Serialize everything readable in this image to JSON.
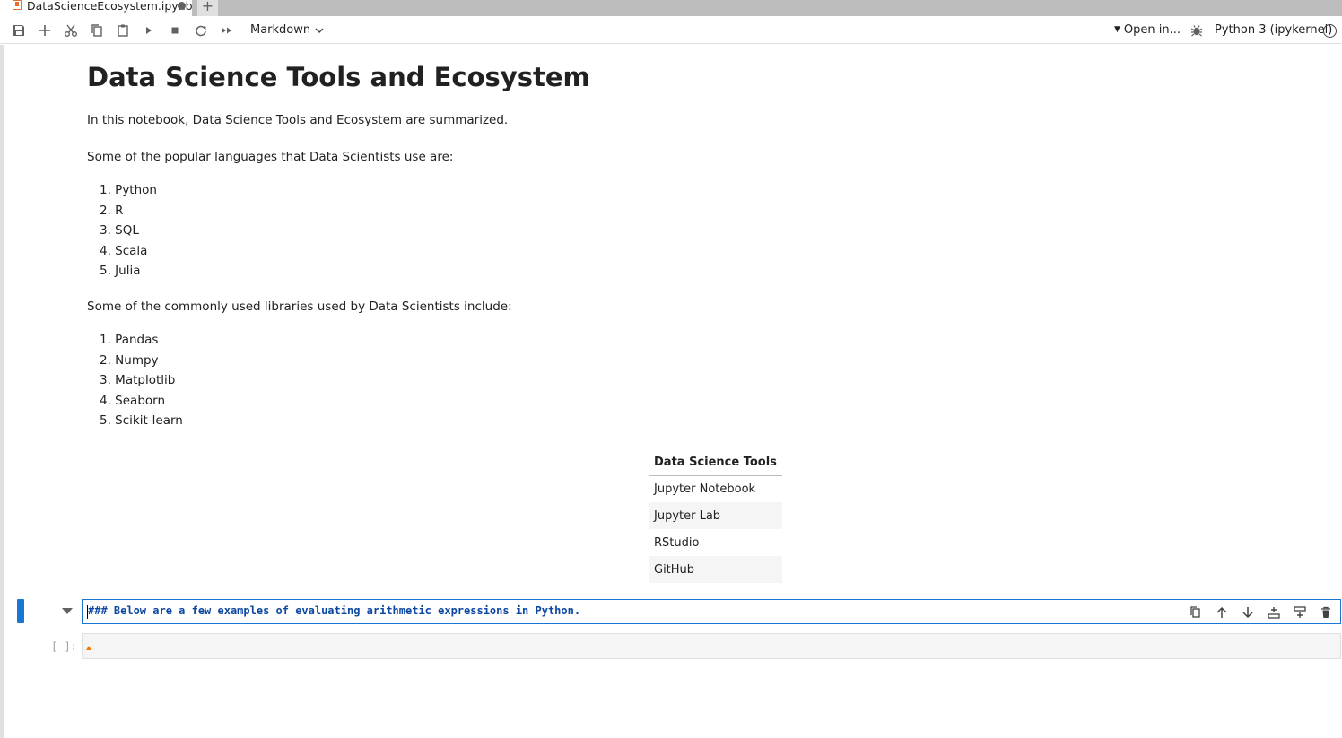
{
  "tab": {
    "title": "DataScienceEcosystem.ipynb",
    "new_tab": "+"
  },
  "toolbar": {
    "buttons": [
      "save-icon",
      "add-cell-icon",
      "cut-icon",
      "copy-icon",
      "paste-icon",
      "run-icon",
      "stop-icon",
      "restart-icon",
      "run-all-icon"
    ],
    "cell_type": "Markdown",
    "open_in": "Open in...",
    "kernel": "Python 3 (ipykernel)"
  },
  "notebook": {
    "title": "Data Science Tools and Ecosystem",
    "intro": "In this notebook, Data Science Tools and Ecosystem are summarized.",
    "languages_intro": "Some of the popular languages that Data Scientists use are:",
    "languages": [
      "1. Python",
      "2. R",
      "3. SQL",
      "4. Scala",
      "5. Julia"
    ],
    "libraries_intro": "Some of the commonly used libraries used by Data Scientists include:",
    "libraries": [
      "1. Pandas",
      "2. Numpy",
      "3. Matplotlib",
      "4. Seaborn",
      "5. Scikit-learn"
    ],
    "tools_table": {
      "header": "Data Science Tools",
      "rows": [
        "Jupyter Notebook",
        "Jupyter Lab",
        "RStudio",
        "GitHub"
      ]
    },
    "active_cell": {
      "source": "### Below are a few examples of evaluating arithmetic expressions in Python.",
      "actions": [
        "duplicate-icon",
        "move-up-icon",
        "move-down-icon",
        "insert-above-icon",
        "insert-below-icon",
        "delete-icon"
      ]
    },
    "code_cell": {
      "prompt": "[ ]:"
    }
  },
  "colors": {
    "accent": "#1976d2",
    "tabbar": "#bdbdbd",
    "markdown_source": "#0d47a1"
  }
}
